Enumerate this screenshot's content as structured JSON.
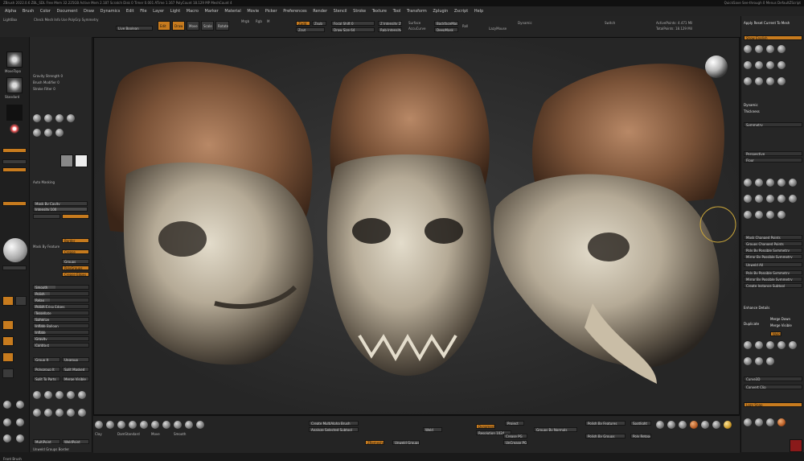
{
  "titlebar": {
    "info": "ZBrush 2022.0.6   ZBL_SDL   Free Mem 32.225GB   Active Mem 2.187   Scratch Disk 0   Timer 0.001   ATime 1.167   PolyCount 18.129 MP   MeshCount 4",
    "right": "QuickSave  See-through 0  Menus  DefaultZScript"
  },
  "menubar": [
    "Alpha",
    "Brush",
    "Color",
    "Document",
    "Draw",
    "Dynamics",
    "Edit",
    "File",
    "Layer",
    "Light",
    "Macro",
    "Marker",
    "Material",
    "Movie",
    "Picker",
    "Preferences",
    "Render",
    "Stencil",
    "Stroke",
    "Texture",
    "Tool",
    "Transform",
    "Zplugin",
    "Zscript",
    "Help"
  ],
  "toolbar": {
    "chk_mesh": "Check Mesh Info  Use PolyGrp Symmetry",
    "live_boolean": "Live Boolean",
    "edit": "Edit",
    "draw": "Draw",
    "move": "Move",
    "scale": "Scale",
    "rotate": "Rotate",
    "mrgb": "Mrgb",
    "rgb": "Rgb",
    "m": "M",
    "zadd": "Zadd",
    "zsub": "Zsub",
    "zcut": "Zcut",
    "focal_shift": "Focal Shift 0",
    "draw_size": "Draw Size 64",
    "dynamic": "Dynamic",
    "z_intensity": "Z Intensity 25",
    "rgb_intensity": "Rgb Intensity 100",
    "surface": "Surface",
    "accucurve": "AccuCurve",
    "backface": "BackfaceMask",
    "deepmask": "DeepMask",
    "lazymouse": "LazyMouse",
    "roll": "Roll",
    "switch": "Switch",
    "totalpoints": "TotalPoints: 18.129 Mil",
    "active_points": "ActivePoints: 4.471 Mil",
    "apply_reset": "Apply Reset Current To Mesh"
  },
  "left_tray": {
    "brushes": [
      "MoveTopo",
      "Standard",
      "ClayBuildup",
      "DamStandard",
      "TrimDynamic",
      "hPolish"
    ],
    "items": [
      "Gravity Strength 0",
      "Brush Modifier 0",
      "Stroke Filter 0",
      "Auto Masking",
      "Mask By Cavity",
      "Intensity 100",
      "Mask By Feature",
      "Border",
      "Crease",
      "Groups",
      "PolyGroups",
      "Crease Edges"
    ],
    "sliders": [
      "Smooth",
      "Polish",
      "Relax",
      "Polish Crisp Edges",
      "Tessellate",
      "Spherize",
      "Inflate Balloon",
      "Inflate",
      "Gravity",
      "Contrast"
    ],
    "group_btns": [
      "Group It",
      "Ungroup",
      "Polygroup It",
      "Split Masked",
      "Split To Parts",
      "Merge Visible"
    ],
    "bottom": [
      "Front Brush",
      "MultiPoint",
      "WeldPoint",
      "Unweld Groups Border"
    ]
  },
  "viewport": {},
  "bottom_shelf": {
    "brushes": [
      "Clay",
      "ClayBuildup",
      "DamStandard",
      "hPolish",
      "Inflate",
      "Move",
      "Pinch",
      "Smooth",
      "Standard",
      "TrimDynamic"
    ],
    "labels": [
      "Create MultiAlpha Brush",
      "Analyze Selected Subtool",
      "ZRemesher",
      "Unweld Groups",
      "Weld",
      "Dynamesh",
      "Resolution 1024",
      "Project",
      "Polish By Features",
      "Polish By Groups",
      "Groups By Normals",
      "Crease PG",
      "UnCrease PG",
      "Spotlight",
      "Poly Retopology"
    ]
  },
  "right_panel": {
    "header": "Apply Reset Current To Mesh",
    "items": [
      "Show English",
      "Dynamic",
      "Thickness",
      "Symmetry",
      "Perspective",
      "Floor",
      "Local",
      "L.Sym",
      "Xyz",
      "Mask Changed Points",
      "Groups Changed Points",
      "Poly By Possible Symmetry",
      "Mirror By Possible Symmetry",
      "Unweld All",
      "Poly By Possible Symmetry",
      "Mirror By Possible Symmetry",
      "Create Instance Subtool",
      "Enhance Details",
      "Duplicate",
      "Merge Down",
      "Merge Visible",
      "Weld",
      "SK_Sun_Boo",
      "SculptBrush",
      "Clone",
      "Curve3D",
      "Curve Mode",
      "Convert Clip",
      "Lazy Snap",
      "Bend Arc",
      "Snap",
      "Preset"
    ],
    "materials": [
      "BasicMaterial",
      "MatCap_Gray",
      "SkinShade4",
      "Metal01",
      "Metal02",
      "Chrome",
      "Silver",
      "Gold"
    ]
  },
  "colors": {
    "accent": "#c77b1e",
    "panel": "#262626",
    "viewport": "#2e2e2e"
  }
}
